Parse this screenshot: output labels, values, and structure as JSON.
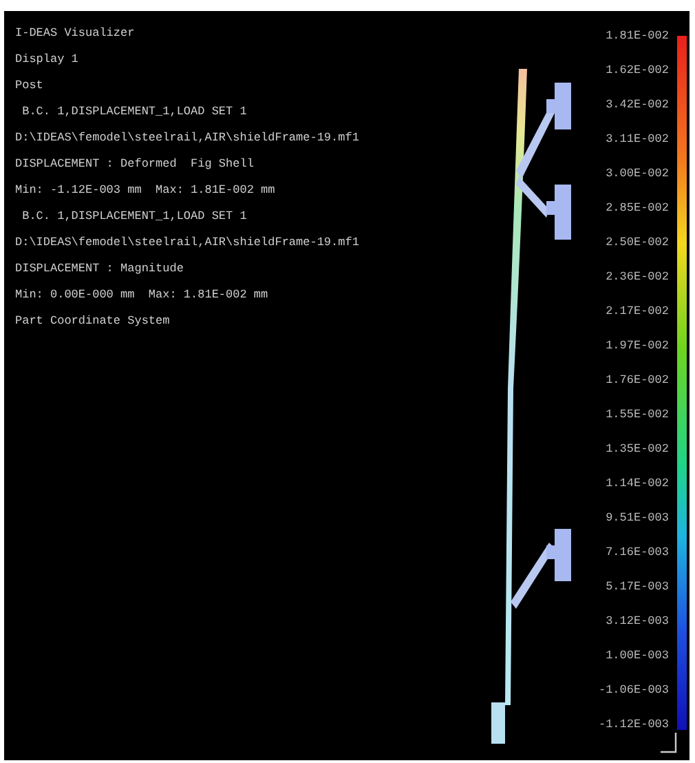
{
  "info_lines": [
    "I-DEAS Visualizer",
    "Display 1",
    "Post",
    " B.C. 1,DISPLACEMENT_1,LOAD SET 1",
    "D:\\IDEAS\\femodel\\steelrail,AIR\\shieldFrame-19.mf1",
    "DISPLACEMENT : Deformed  Fig Shell",
    "Min: -1.12E-003 mm  Max: 1.81E-002 mm",
    " B.C. 1,DISPLACEMENT_1,LOAD SET 1",
    "D:\\IDEAS\\femodel\\steelrail,AIR\\shieldFrame-19.mf1",
    "DISPLACEMENT : Magnitude",
    "Min: 0.00E-000 mm  Max: 1.81E-002 mm",
    "Part Coordinate System"
  ],
  "legend": {
    "labels": [
      "1.81E-002",
      "1.62E-002",
      "3.42E-002",
      "3.11E-002",
      "3.00E-002",
      "2.85E-002",
      "2.50E-002",
      "2.36E-002",
      "2.17E-002",
      "1.97E-002",
      "1.76E-002",
      "1.55E-002",
      "1.35E-002",
      "1.14E-002",
      "9.51E-003",
      "7.16E-003",
      "5.17E-003",
      "3.12E-003",
      "1.00E-003",
      "-1.06E-003",
      "-1.12E-003"
    ]
  }
}
